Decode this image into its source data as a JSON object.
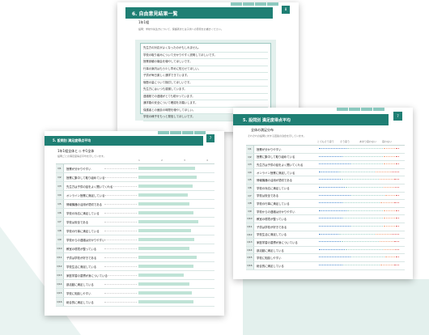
{
  "doc_back": {
    "title": "6. 自由意見結果一覧",
    "page": "8",
    "subheading": "1年1組",
    "intro": "設問：学校や先生方について、保護者または子供への意見をお書きください。",
    "comments": [
      "先生方の対応がよくなったのかもしれません。",
      "学校の取り組みについて分かりやすく説明してほしいです。",
      "授業参観の機会を増やしてほしいです。",
      "行事の案内はもう少し早めに知らせてほしい。",
      "子供が毎日楽しく通学できています。",
      "宿題の量について検討してほしいです。",
      "先生方にはいつも感謝しています。",
      "連絡帳での連絡がとても助かっています。",
      "通学路の安全について確認をお願いします。",
      "保護者との面談の時間を増やしてほしい。",
      "学校の様子をもっと発信してほしいです。"
    ]
  },
  "doc_left": {
    "title": "5. 設問別 満足度得点平均",
    "page": "7",
    "subheading": "1年1組全体と ◇ 中1全体",
    "note": "設問ごとの満足度得点平均を示しています。",
    "scale": [
      "1",
      "2",
      "3",
      "4"
    ],
    "questions": [
      {
        "no": "Q1",
        "text": "授業が分かりやすい"
      },
      {
        "no": "Q2",
        "text": "授業に集中して取り組めている"
      },
      {
        "no": "Q3",
        "text": "先生方は子供の話をよく聞いてくれる"
      },
      {
        "no": "Q4",
        "text": "オンライン授業に満足している"
      },
      {
        "no": "Q5",
        "text": "情報機器の活用が適切である"
      },
      {
        "no": "Q6",
        "text": "学校の対応に満足している"
      },
      {
        "no": "Q7",
        "text": "学校は安全である"
      },
      {
        "no": "Q8",
        "text": "学校の行事に満足している"
      },
      {
        "no": "Q9",
        "text": "学校からの連絡は分かりやすい"
      },
      {
        "no": "Q10",
        "text": "教室の環境が整っている"
      },
      {
        "no": "Q11",
        "text": "子供は学校が好きである"
      },
      {
        "no": "Q12",
        "text": "学校生活に満足している"
      },
      {
        "no": "Q13",
        "text": "家庭学習の習慣が身についている"
      },
      {
        "no": "Q14",
        "text": "部活動に満足している"
      },
      {
        "no": "Q15",
        "text": "学校に相談しやすい"
      },
      {
        "no": "Q16",
        "text": "総合的に満足している"
      }
    ]
  },
  "doc_right": {
    "title": "5. 設問別 満足度得点平均",
    "page": "7",
    "subheading": "全体の満足分布",
    "note": "それぞれの設問に対する回答の割合を示しています。",
    "columns": [
      "とてもそう思う",
      "そう思う",
      "あまり思わない",
      "思わない"
    ],
    "questions": [
      {
        "no": "Q1",
        "text": "授業が分かりやすい"
      },
      {
        "no": "Q2",
        "text": "授業に集中して取り組めている"
      },
      {
        "no": "Q3",
        "text": "先生方は子供の話をよく聞いてくれる"
      },
      {
        "no": "Q4",
        "text": "オンライン授業に満足している"
      },
      {
        "no": "Q5",
        "text": "情報機器の活用が適切である"
      },
      {
        "no": "Q6",
        "text": "学校の対応に満足している"
      },
      {
        "no": "Q7",
        "text": "学校は安全である"
      },
      {
        "no": "Q8",
        "text": "学校の行事に満足している"
      },
      {
        "no": "Q9",
        "text": "学校からの連絡は分かりやすい"
      },
      {
        "no": "Q10",
        "text": "教室の環境が整っている"
      },
      {
        "no": "Q11",
        "text": "子供は学校が好きである"
      },
      {
        "no": "Q12",
        "text": "学校生活に満足している"
      },
      {
        "no": "Q13",
        "text": "家庭学習の習慣が身についている"
      },
      {
        "no": "Q14",
        "text": "部活動に満足している"
      },
      {
        "no": "Q15",
        "text": "学校に相談しやすい"
      },
      {
        "no": "Q16",
        "text": "総合的に満足している"
      }
    ]
  },
  "colors": {
    "brand": "#1f7f74",
    "accent_light": "#bfe3d6",
    "bg_shape": "#e3f0ed"
  }
}
